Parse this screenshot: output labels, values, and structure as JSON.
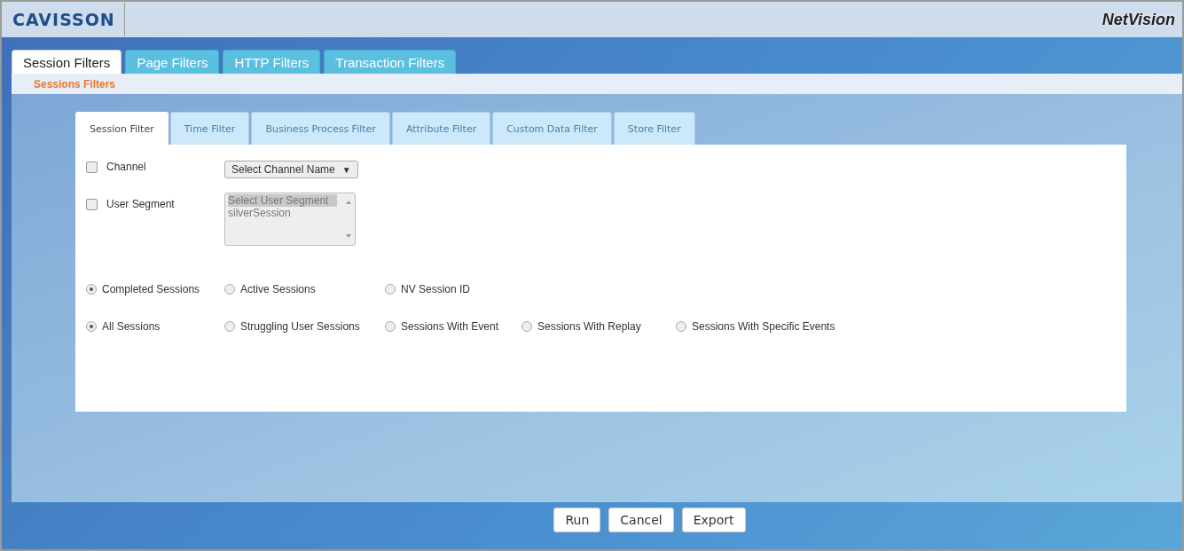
{
  "header": {
    "logo": "CAVISSON",
    "product": "NetVision"
  },
  "main_tabs": [
    {
      "label": "Session Filters",
      "selected": true
    },
    {
      "label": "Page Filters",
      "selected": false
    },
    {
      "label": "HTTP Filters",
      "selected": false
    },
    {
      "label": "Transaction Filters",
      "selected": false
    }
  ],
  "section_title": "Sessions Filters",
  "filter_tabs": [
    {
      "label": "Session Filter",
      "selected": true
    },
    {
      "label": "Time Filter",
      "selected": false
    },
    {
      "label": "Business Process Filter",
      "selected": false
    },
    {
      "label": "Attribute Filter",
      "selected": false
    },
    {
      "label": "Custom Data Filter",
      "selected": false
    },
    {
      "label": "Store Filter",
      "selected": false
    }
  ],
  "channel": {
    "label": "Channel",
    "checked": false,
    "dropdown": "Select Channel Name",
    "arrow": "▼"
  },
  "user_segment": {
    "label": "User Segment",
    "checked": false,
    "options": [
      {
        "label": "Select User Segment",
        "selected": true
      },
      {
        "label": "silverSession",
        "selected": false
      }
    ]
  },
  "radio_groups": [
    {
      "options": [
        {
          "label": "Completed Sessions",
          "selected": true
        },
        {
          "label": "Active Sessions",
          "selected": false
        },
        {
          "label": "NV Session ID",
          "selected": false
        }
      ]
    },
    {
      "options": [
        {
          "label": "All Sessions",
          "selected": true
        },
        {
          "label": "Struggling User Sessions",
          "selected": false
        },
        {
          "label": "Sessions With Event",
          "selected": false
        },
        {
          "label": "Sessions With Replay",
          "selected": false
        },
        {
          "label": "Sessions With Specific Events",
          "selected": false
        }
      ]
    }
  ],
  "buttons": [
    "Run",
    "Cancel",
    "Export"
  ]
}
